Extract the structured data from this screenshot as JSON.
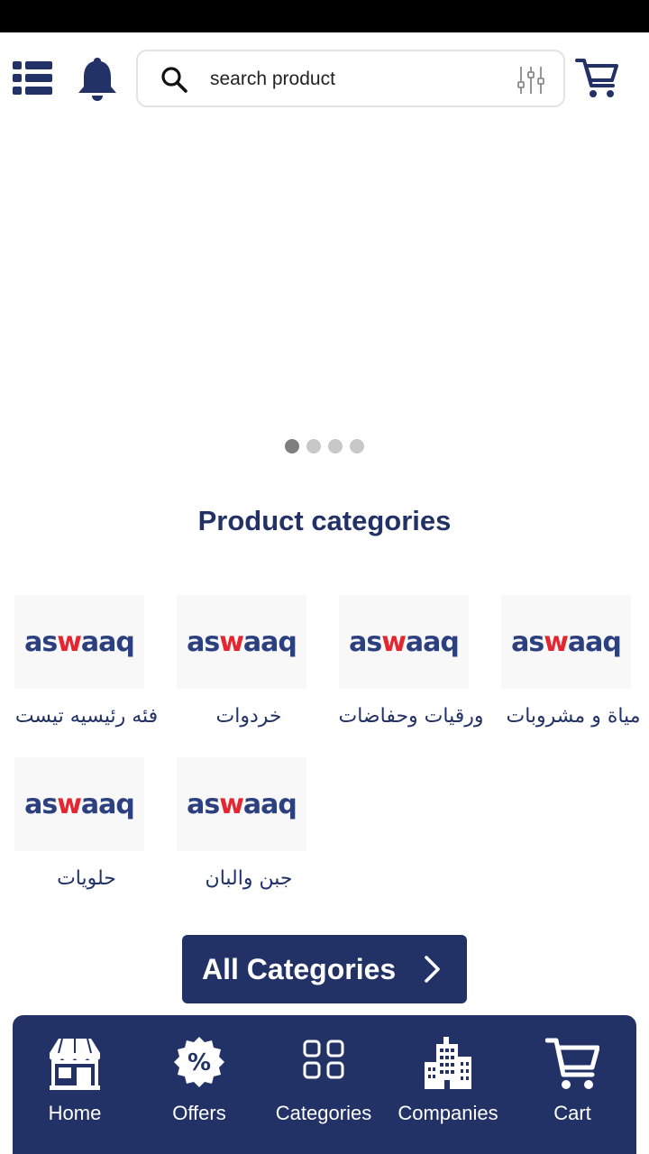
{
  "header": {
    "search_placeholder": "search product",
    "icons": [
      "menu-list-icon",
      "bell-icon",
      "search-icon",
      "filter-sliders-icon",
      "cart-icon"
    ]
  },
  "carousel": {
    "dot_count": 4,
    "active_index": 0
  },
  "section": {
    "title": "Product categories"
  },
  "categories": [
    {
      "label": "فئه رئيسيه تيست",
      "logo": "aswaaq"
    },
    {
      "label": "خردوات",
      "logo": "aswaaq"
    },
    {
      "label": "ورقيات وحفاضات",
      "logo": "aswaaq"
    },
    {
      "label": "مياة و مشروبات",
      "logo": "aswaaq"
    },
    {
      "label": "حلويات",
      "logo": "aswaaq"
    },
    {
      "label": "جبن والبان",
      "logo": "aswaaq"
    }
  ],
  "all_categories_label": "All Categories",
  "bottom_nav": [
    {
      "label": "Home",
      "icon": "storefront-icon"
    },
    {
      "label": "Offers",
      "icon": "percent-badge-icon"
    },
    {
      "label": "Categories",
      "icon": "grid-icon"
    },
    {
      "label": "Companies",
      "icon": "building-icon"
    },
    {
      "label": "Cart",
      "icon": "cart-icon"
    }
  ],
  "colors": {
    "primary": "#223166",
    "logo_blue": "#2c3f7e",
    "logo_red": "#e3262f",
    "dot_active": "#7f7f7f",
    "dot_inactive": "#c7c7c7"
  }
}
